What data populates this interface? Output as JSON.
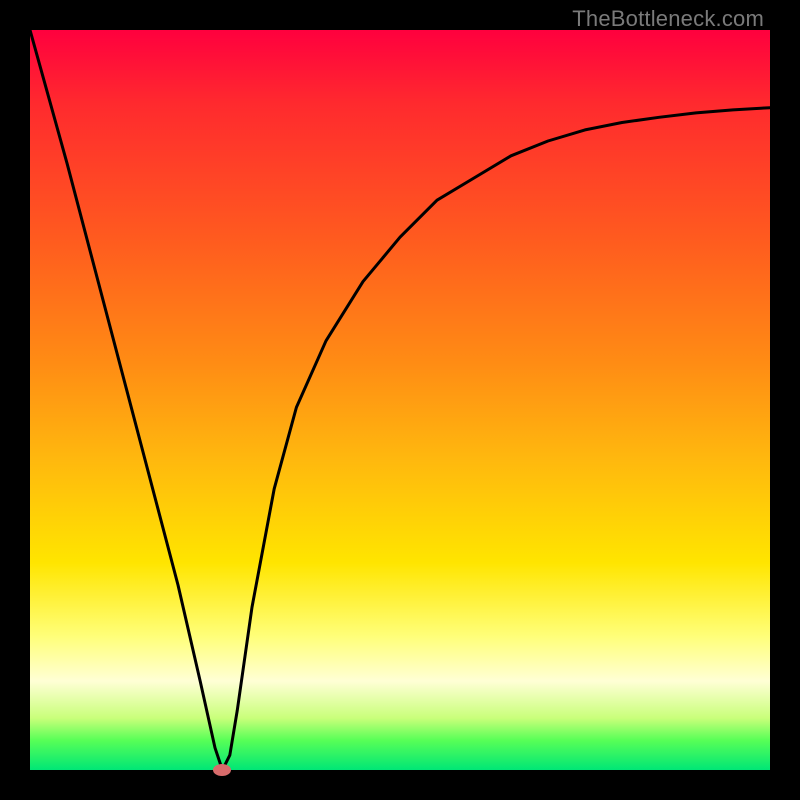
{
  "watermark": "TheBottleneck.com",
  "chart_data": {
    "type": "line",
    "title": "",
    "xlabel": "",
    "ylabel": "",
    "xlim": [
      0,
      100
    ],
    "ylim": [
      0,
      100
    ],
    "grid": false,
    "legend": false,
    "series": [
      {
        "name": "bottleneck-curve",
        "x": [
          0,
          5,
          10,
          15,
          20,
          23,
          25,
          26,
          27,
          28,
          30,
          33,
          36,
          40,
          45,
          50,
          55,
          60,
          65,
          70,
          75,
          80,
          85,
          90,
          95,
          100
        ],
        "y": [
          100,
          82,
          63,
          44,
          25,
          12,
          3,
          0,
          2,
          8,
          22,
          38,
          49,
          58,
          66,
          72,
          77,
          80,
          83,
          85,
          86.5,
          87.5,
          88.2,
          88.8,
          89.2,
          89.5
        ]
      }
    ],
    "annotations": [
      {
        "name": "minimum-marker",
        "x": 26,
        "y": 0,
        "shape": "ellipse",
        "color": "#d86b6b"
      }
    ],
    "background_gradient": {
      "direction": "top-to-bottom",
      "stops": [
        {
          "pos": 0,
          "color": "#ff003e"
        },
        {
          "pos": 28,
          "color": "#ff5a1f"
        },
        {
          "pos": 58,
          "color": "#ffb80e"
        },
        {
          "pos": 82,
          "color": "#ffff7a"
        },
        {
          "pos": 100,
          "color": "#00e676"
        }
      ]
    }
  }
}
